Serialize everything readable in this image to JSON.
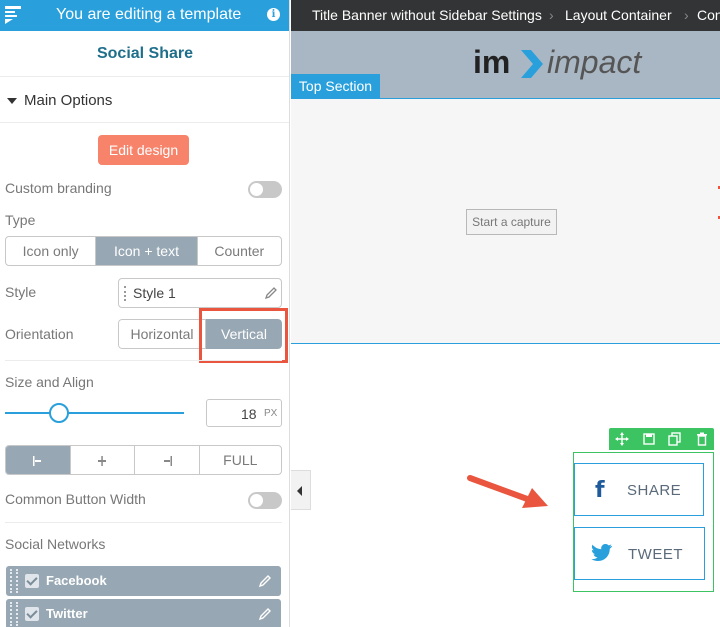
{
  "panel": {
    "topbar_title": "You are editing a template",
    "title": "Social Share",
    "main_options_label": "Main Options",
    "edit_design_label": "Edit design",
    "custom_branding_label": "Custom branding",
    "type_label": "Type",
    "type_options": [
      "Icon only",
      "Icon + text",
      "Counter"
    ],
    "type_selected": "Icon + text",
    "style_label": "Style",
    "style_value": "Style 1",
    "orientation_label": "Orientation",
    "orientation_options": [
      "Horizontal",
      "Vertical"
    ],
    "orientation_selected": "Vertical",
    "size_align_label": "Size and Align",
    "size_value": "18",
    "size_unit": "PX",
    "size_slider_fraction": 0.3,
    "align_full_label": "FULL",
    "common_width_label": "Common Button Width",
    "social_networks_label": "Social Networks",
    "networks": [
      "Facebook",
      "Twitter"
    ]
  },
  "preview": {
    "breadcrumbs": [
      "Title Banner without Sidebar Settings",
      "Layout Container",
      "Con"
    ],
    "logo_im": "im",
    "logo_impact": "impact",
    "top_section_label": "Top Section",
    "capture_label": "Start a capture",
    "share_label": "SHARE",
    "tweet_label": "TWEET",
    "facebook_glyph": "f"
  },
  "colors": {
    "accent": "#29a0dc",
    "edit_button": "#f7836b",
    "active_option": "#97a7b3",
    "highlight": "#e9553f",
    "widget_green": "#3bc461"
  }
}
